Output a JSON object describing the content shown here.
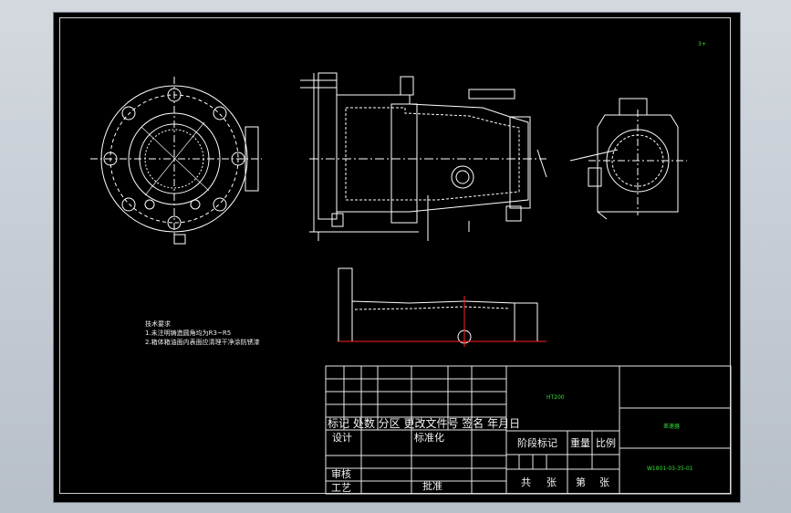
{
  "corner_mark": "3+",
  "notes": {
    "title": "技术要求",
    "lines": [
      "1.未注明铸造圆角均为R3~R5",
      "2.箱体箱油面内表面应清理干净涂防锈漆"
    ]
  },
  "title_block": {
    "material": "HT200",
    "part_name": "差速器",
    "drawing_number": "W1801-03-35-01",
    "revision_header": "标记 处数 分区 更改文件号 签名 年月日",
    "design": "设计",
    "standardize": "标准化",
    "stage_mark": "阶段标记",
    "weight": "重量",
    "scale": "比例",
    "review": "审核",
    "process": "工艺",
    "approve": "批准",
    "total": "共",
    "sheets": "张",
    "sheet_no": "第",
    "sheet_unit": "张"
  },
  "colors": {
    "background": "#000000",
    "lines": "#ffffff",
    "text_green": "#36e036",
    "section_red": "#ff2020"
  }
}
